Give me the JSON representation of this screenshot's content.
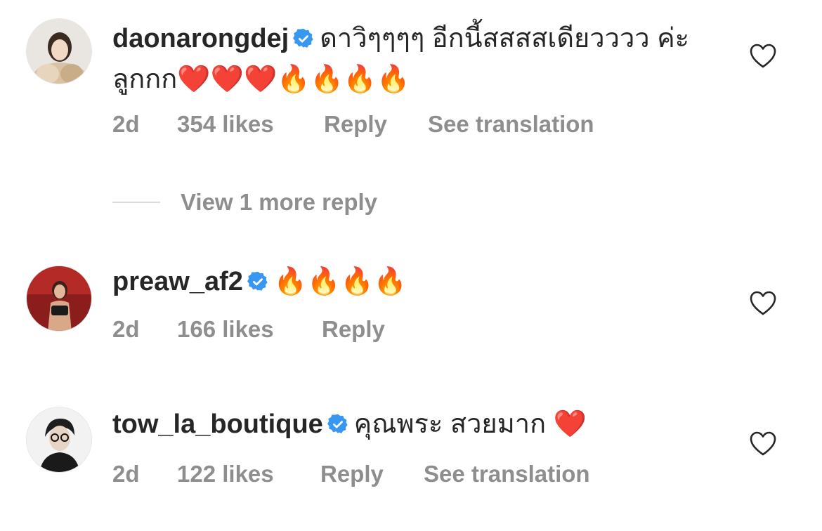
{
  "comments": [
    {
      "username": "daonarongdej",
      "text": "ดาวิๆๆๆๆ อีกนี้สสสสเดียวววว ค่ะลูกกก❤️❤️❤️🔥🔥🔥🔥",
      "time": "2d",
      "likes": "354 likes",
      "reply": "Reply",
      "translate": "See translation",
      "avatar_icon": "profile-photo",
      "like_icon": "heart-outline-icon",
      "verified_icon": "verified-badge-icon"
    },
    {
      "username": "preaw_af2",
      "text": "🔥🔥🔥🔥",
      "time": "2d",
      "likes": "166 likes",
      "reply": "Reply",
      "avatar_icon": "profile-photo",
      "like_icon": "heart-outline-icon",
      "verified_icon": "verified-badge-icon"
    },
    {
      "username": "tow_la_boutique",
      "text": "คุณพระ สวยมาก ❤️",
      "time": "2d",
      "likes": "122 likes",
      "reply": "Reply",
      "translate": "See translation",
      "avatar_icon": "profile-photo",
      "like_icon": "heart-outline-icon",
      "verified_icon": "verified-badge-icon"
    }
  ],
  "more_replies": {
    "label": "View 1 more reply"
  },
  "colors": {
    "text": "#262626",
    "secondary": "#8e8e8e",
    "verified": "#3897f0",
    "divider": "#dbdbdb"
  }
}
